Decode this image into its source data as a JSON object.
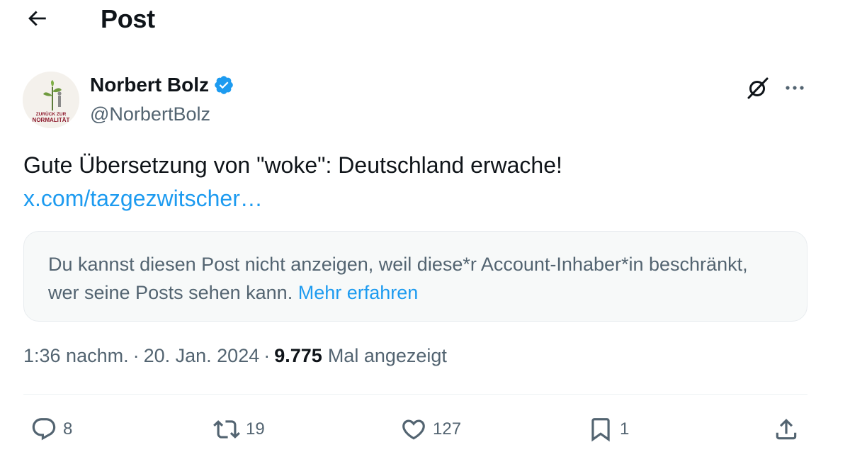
{
  "header": {
    "title": "Post",
    "back_icon": "arrow-left-icon"
  },
  "author": {
    "name": "Norbert Bolz",
    "handle": "@NorbertBolz",
    "verified_color": "#1d9bf0",
    "avatar_caption_line1": "ZURÜCK ZUR",
    "avatar_caption_line2": "NORMALITÄT"
  },
  "post": {
    "text": "Gute Übersetzung von \"woke\": Deutschland erwache!",
    "link": "x.com/tazgezwitscher…"
  },
  "notice": {
    "text": "Du kannst diesen Post nicht anzeigen, weil diese*r Account-Inhaber*in beschränkt, wer seine Posts sehen kann.",
    "link": "Mehr erfahren"
  },
  "meta": {
    "time": "1:36 nachm.",
    "separator": "·",
    "date": "20. Jan. 2024",
    "views_count": "9.775",
    "views_label": "Mal angezeigt"
  },
  "actions": {
    "replies": "8",
    "reposts": "19",
    "likes": "127",
    "bookmarks": "1"
  },
  "colors": {
    "accent": "#1d9bf0",
    "text_primary": "#0f1419",
    "text_secondary": "#536471"
  }
}
